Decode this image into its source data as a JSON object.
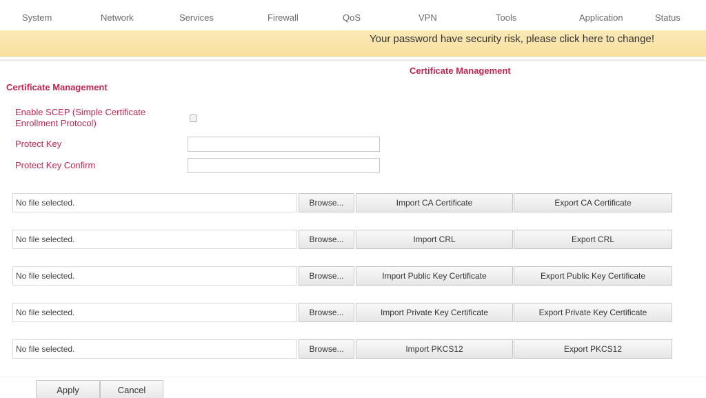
{
  "nav": {
    "items": [
      "System",
      "Network",
      "Services",
      "Firewall",
      "QoS",
      "VPN",
      "Tools",
      "Application",
      "Status"
    ]
  },
  "warning": {
    "text": "Your password have security risk, please click here to change!"
  },
  "page_title": "Certificate Management",
  "section_title": "Certificate Management",
  "form": {
    "scep_label": "Enable SCEP (Simple Certificate Enrollment Protocol)",
    "scep_checked": false,
    "protect_key_label": "Protect Key",
    "protect_key_value": "",
    "protect_key_confirm_label": "Protect Key Confirm",
    "protect_key_confirm_value": ""
  },
  "certificates": [
    {
      "file_status": "No file selected.",
      "browse_label": "Browse...",
      "import_label": "Import CA Certificate",
      "export_label": "Export CA Certificate"
    },
    {
      "file_status": "No file selected.",
      "browse_label": "Browse...",
      "import_label": "Import CRL",
      "export_label": "Export CRL"
    },
    {
      "file_status": "No file selected.",
      "browse_label": "Browse...",
      "import_label": "Import Public Key Certificate",
      "export_label": "Export Public Key Certificate"
    },
    {
      "file_status": "No file selected.",
      "browse_label": "Browse...",
      "import_label": "Import Private Key Certificate",
      "export_label": "Export Private Key Certificate"
    },
    {
      "file_status": "No file selected.",
      "browse_label": "Browse...",
      "import_label": "Import PKCS12",
      "export_label": "Export PKCS12"
    }
  ],
  "actions": {
    "apply_label": "Apply",
    "cancel_label": "Cancel"
  },
  "colors": {
    "accent": "#c2254f",
    "warning_bg": "#f9e4a8"
  }
}
